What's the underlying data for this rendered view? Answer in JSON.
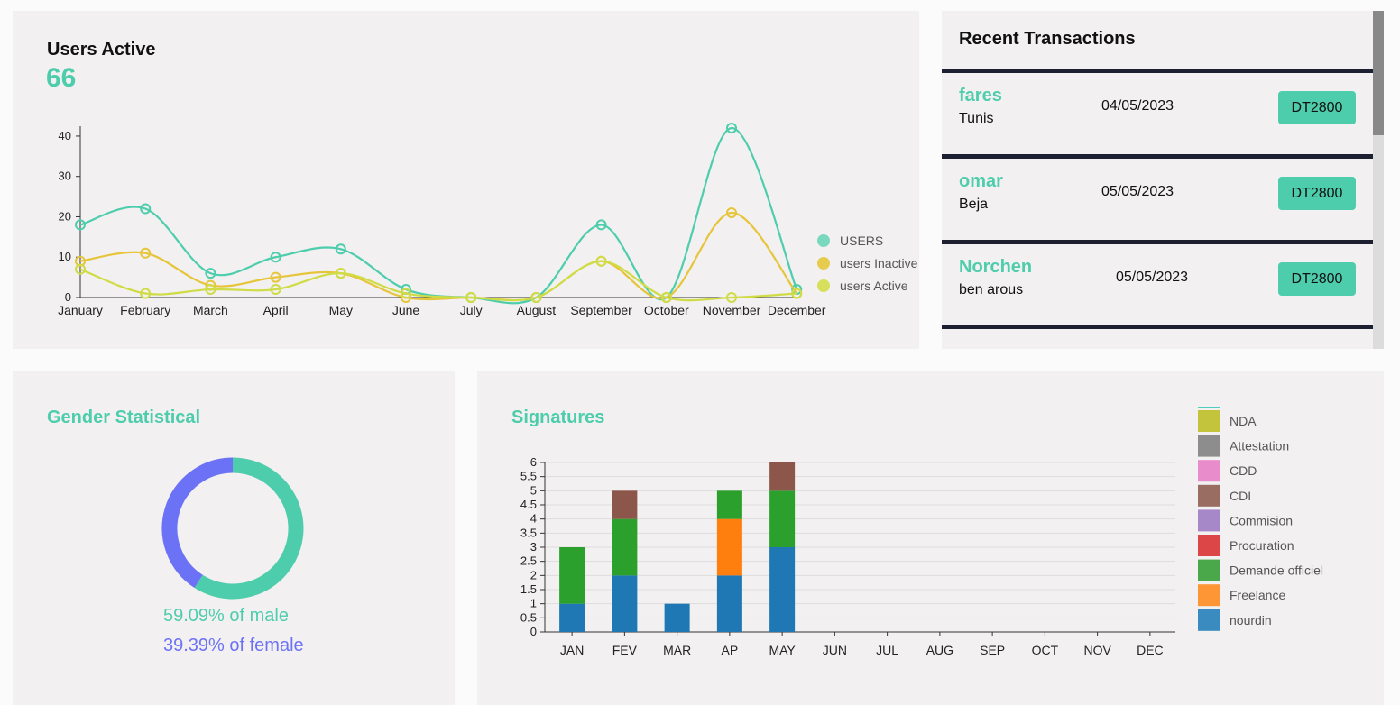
{
  "users_active": {
    "title": "Users Active",
    "count": "66"
  },
  "chart_data": [
    {
      "type": "line",
      "x": [
        "January",
        "February",
        "March",
        "April",
        "May",
        "June",
        "July",
        "August",
        "September",
        "October",
        "November",
        "December"
      ],
      "ylim": [
        0,
        42
      ],
      "yticks": [
        0,
        10,
        20,
        30,
        40
      ],
      "series": [
        {
          "name": "USERS",
          "color": "#4ecdac",
          "values": [
            18,
            22,
            6,
            10,
            12,
            2,
            0,
            0,
            18,
            0,
            42,
            2
          ]
        },
        {
          "name": "users Inactive",
          "color": "#e6c53b",
          "values": [
            9,
            11,
            3,
            5,
            6,
            0,
            0,
            0,
            9,
            0,
            21,
            1
          ]
        },
        {
          "name": "users Active",
          "color": "#cfdc45",
          "values": [
            7,
            1,
            2,
            2,
            6,
            1,
            0,
            0,
            9,
            0,
            0,
            1
          ]
        }
      ]
    },
    {
      "type": "bar",
      "stacked": true,
      "categories": [
        "JAN",
        "FEV",
        "MAR",
        "AP",
        "MAY",
        "JUN",
        "JUL",
        "AUG",
        "SEP",
        "OCT",
        "NOV",
        "DEC"
      ],
      "ylim": [
        0,
        6
      ],
      "yticks": [
        "0",
        "0.5",
        "1",
        "1.5",
        "2",
        "2.5",
        "3",
        "3.5",
        "4",
        "4.5",
        "5",
        "5.5",
        "6"
      ],
      "series": [
        {
          "name": "nourdin",
          "color": "#1f77b4",
          "values": [
            1,
            2,
            1,
            2,
            3,
            0,
            0,
            0,
            0,
            0,
            0,
            0
          ]
        },
        {
          "name": "Freelance",
          "color": "#ff7f0e",
          "values": [
            0,
            0,
            0,
            2,
            0,
            0,
            0,
            0,
            0,
            0,
            0,
            0
          ]
        },
        {
          "name": "Demande officiel",
          "color": "#2ca02c",
          "values": [
            2,
            2,
            0,
            1,
            2,
            0,
            0,
            0,
            0,
            0,
            0,
            0
          ]
        },
        {
          "name": "Procuration",
          "color": "#d62728",
          "values": [
            0,
            0,
            0,
            0,
            0,
            0,
            0,
            0,
            0,
            0,
            0,
            0
          ]
        },
        {
          "name": "Commision",
          "color": "#9467bd",
          "values": [
            0,
            0,
            0,
            0,
            0,
            0,
            0,
            0,
            0,
            0,
            0,
            0
          ]
        },
        {
          "name": "CDI",
          "color": "#8c564b",
          "values": [
            0,
            1,
            0,
            0,
            1,
            0,
            0,
            0,
            0,
            0,
            0,
            0
          ]
        },
        {
          "name": "CDD",
          "color": "#e377c2",
          "values": [
            0,
            0,
            0,
            0,
            0,
            0,
            0,
            0,
            0,
            0,
            0,
            0
          ]
        },
        {
          "name": "Attestation",
          "color": "#7f7f7f",
          "values": [
            0,
            0,
            0,
            0,
            0,
            0,
            0,
            0,
            0,
            0,
            0,
            0
          ]
        },
        {
          "name": "NDA",
          "color": "#bcbd22",
          "values": [
            0,
            0,
            0,
            0,
            0,
            0,
            0,
            0,
            0,
            0,
            0,
            0
          ]
        }
      ],
      "legend": [
        "NDA",
        "Attestation",
        "CDD",
        "CDI",
        "Commision",
        "Procuration",
        "Demande officiel",
        "Freelance",
        "nourdin"
      ],
      "legend_colors": [
        "#c3c43b",
        "#8d8d8d",
        "#e88ccc",
        "#9a6d63",
        "#a688c8",
        "#dc4646",
        "#4aa84a",
        "#ff9636",
        "#3a8bc0"
      ]
    },
    {
      "type": "pie",
      "donut": true,
      "values": [
        {
          "label": "male",
          "value": 59.09,
          "color": "#4ecdac"
        },
        {
          "label": "female",
          "value": 39.39,
          "color": "#6c72f5"
        }
      ]
    }
  ],
  "transactions": {
    "title": "Recent Transactions",
    "items": [
      {
        "name": "fares",
        "city": "Tunis",
        "date": "04/05/2023",
        "amount": "DT2800"
      },
      {
        "name": "omar",
        "city": "Beja",
        "date": "05/05/2023",
        "amount": "DT2800"
      },
      {
        "name": "Norchen",
        "city": "ben arous",
        "date": "05/05/2023",
        "amount": "DT2800"
      }
    ]
  },
  "gender": {
    "title": "Gender Statistical",
    "male_text": "59.09% of male",
    "female_text": "39.39% of female",
    "male_color": "#4ecdac",
    "female_color": "#6c72f5"
  },
  "signatures": {
    "title": "Signatures"
  }
}
